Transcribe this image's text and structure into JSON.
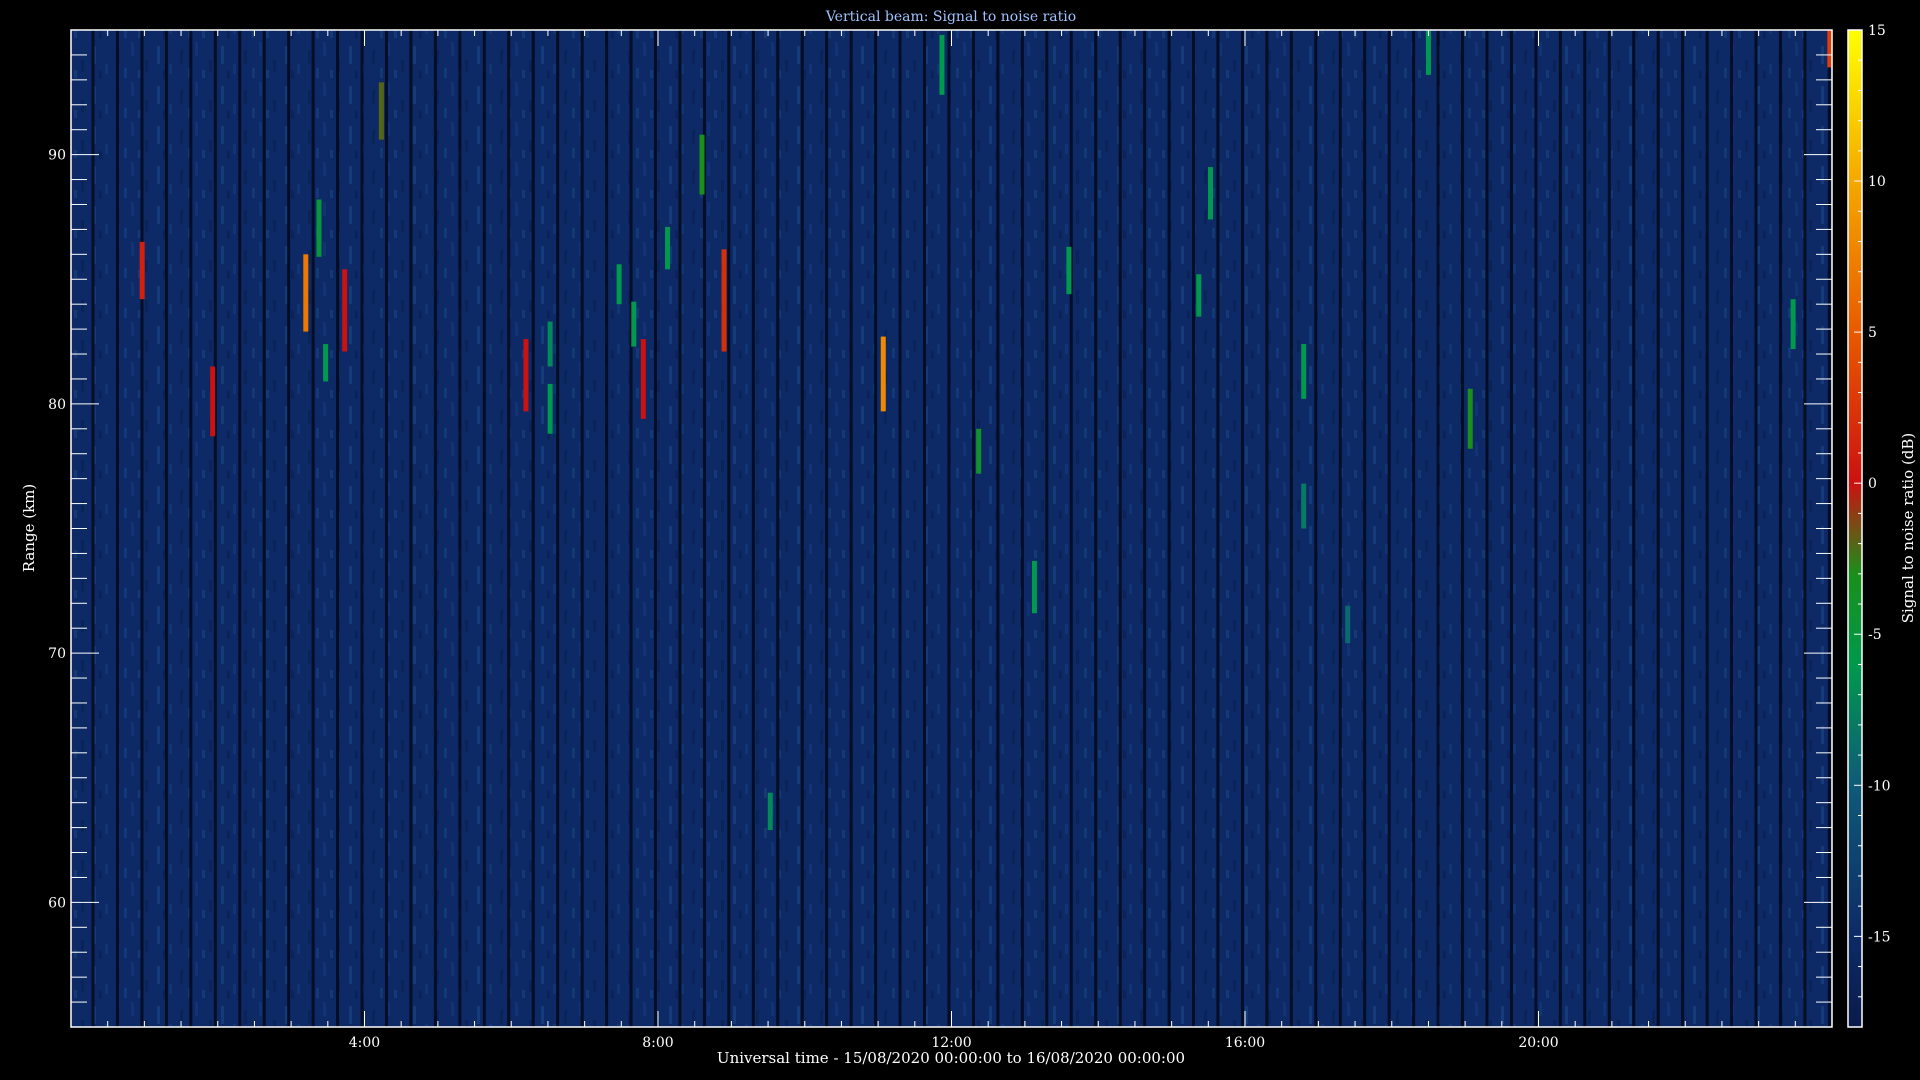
{
  "chart_data": {
    "type": "heatmap",
    "title": "Vertical beam: Signal to noise ratio",
    "xlabel": "Universal time - 15/08/2020 00:00:00 to 16/08/2020 00:00:00",
    "ylabel": "Range (km)",
    "colorbar_label": "Signal to noise ratio (dB)",
    "x_unit": "hours UT",
    "xlim": [
      0,
      24
    ],
    "ylim": [
      55,
      95
    ],
    "x_ticks": [
      {
        "value": 4,
        "label": "4:00"
      },
      {
        "value": 8,
        "label": "8:00"
      },
      {
        "value": 12,
        "label": "12:00"
      },
      {
        "value": 16,
        "label": "16:00"
      },
      {
        "value": 20,
        "label": "20:00"
      }
    ],
    "y_ticks": [
      {
        "value": 60,
        "label": "60"
      },
      {
        "value": 70,
        "label": "70"
      },
      {
        "value": 80,
        "label": "80"
      },
      {
        "value": 90,
        "label": "90"
      }
    ],
    "colorbar_range": [
      -18,
      15
    ],
    "colorbar_ticks": [
      {
        "value": 15,
        "label": "15"
      },
      {
        "value": 10,
        "label": "10"
      },
      {
        "value": 5,
        "label": "5"
      },
      {
        "value": 0,
        "label": "0"
      },
      {
        "value": -5,
        "label": "-5"
      },
      {
        "value": -10,
        "label": "-10"
      },
      {
        "value": -15,
        "label": "-15"
      }
    ],
    "colormap": [
      {
        "value": -18,
        "color": "#0b1a4a"
      },
      {
        "value": -15,
        "color": "#0d2a66"
      },
      {
        "value": -10,
        "color": "#0f5a78"
      },
      {
        "value": -6,
        "color": "#00994d"
      },
      {
        "value": -3,
        "color": "#1a8f1a"
      },
      {
        "value": 0,
        "color": "#cc1111"
      },
      {
        "value": 5,
        "color": "#e85a00"
      },
      {
        "value": 10,
        "color": "#f5a800"
      },
      {
        "value": 15,
        "color": "#ffff00"
      }
    ],
    "background_snr_db": -15,
    "echoes": [
      {
        "t": 0.97,
        "r0": 84.2,
        "r1": 86.5,
        "snr": 1
      },
      {
        "t": 1.93,
        "r0": 78.7,
        "r1": 81.5,
        "snr": 0
      },
      {
        "t": 3.2,
        "r0": 82.9,
        "r1": 86.0,
        "snr": 7
      },
      {
        "t": 3.38,
        "r0": 85.9,
        "r1": 88.2,
        "snr": -5
      },
      {
        "t": 3.47,
        "r0": 80.9,
        "r1": 82.4,
        "snr": -6
      },
      {
        "t": 3.73,
        "r0": 82.1,
        "r1": 85.4,
        "snr": 0
      },
      {
        "t": 4.23,
        "r0": 90.6,
        "r1": 92.9,
        "snr": -2
      },
      {
        "t": 6.2,
        "r0": 79.7,
        "r1": 82.6,
        "snr": 0
      },
      {
        "t": 6.53,
        "r0": 78.8,
        "r1": 80.8,
        "snr": -6
      },
      {
        "t": 6.53,
        "r0": 81.5,
        "r1": 83.3,
        "snr": -7
      },
      {
        "t": 7.47,
        "r0": 84.0,
        "r1": 85.6,
        "snr": -6
      },
      {
        "t": 7.67,
        "r0": 82.3,
        "r1": 84.1,
        "snr": -6
      },
      {
        "t": 7.8,
        "r0": 79.4,
        "r1": 82.6,
        "snr": 0
      },
      {
        "t": 8.13,
        "r0": 85.4,
        "r1": 87.1,
        "snr": -6
      },
      {
        "t": 8.6,
        "r0": 88.4,
        "r1": 90.8,
        "snr": -3
      },
      {
        "t": 8.9,
        "r0": 82.1,
        "r1": 86.2,
        "snr": 2
      },
      {
        "t": 9.53,
        "r0": 62.9,
        "r1": 64.4,
        "snr": -7
      },
      {
        "t": 11.07,
        "r0": 79.7,
        "r1": 82.7,
        "snr": 8
      },
      {
        "t": 11.87,
        "r0": 92.4,
        "r1": 94.8,
        "snr": -6
      },
      {
        "t": 12.37,
        "r0": 77.2,
        "r1": 79.0,
        "snr": -4
      },
      {
        "t": 13.13,
        "r0": 71.6,
        "r1": 73.7,
        "snr": -6
      },
      {
        "t": 13.6,
        "r0": 84.4,
        "r1": 86.3,
        "snr": -6
      },
      {
        "t": 15.37,
        "r0": 83.5,
        "r1": 85.2,
        "snr": -6
      },
      {
        "t": 15.53,
        "r0": 87.4,
        "r1": 89.5,
        "snr": -6
      },
      {
        "t": 16.8,
        "r0": 80.2,
        "r1": 82.4,
        "snr": -6
      },
      {
        "t": 16.8,
        "r0": 75.0,
        "r1": 76.8,
        "snr": -8
      },
      {
        "t": 17.4,
        "r0": 70.4,
        "r1": 71.9,
        "snr": -9
      },
      {
        "t": 18.5,
        "r0": 93.2,
        "r1": 95.0,
        "snr": -6
      },
      {
        "t": 19.07,
        "r0": 78.2,
        "r1": 80.6,
        "snr": -3
      },
      {
        "t": 23.47,
        "r0": 82.2,
        "r1": 84.2,
        "snr": -6
      },
      {
        "t": 23.97,
        "r0": 93.5,
        "r1": 95.0,
        "snr": 3
      }
    ]
  }
}
